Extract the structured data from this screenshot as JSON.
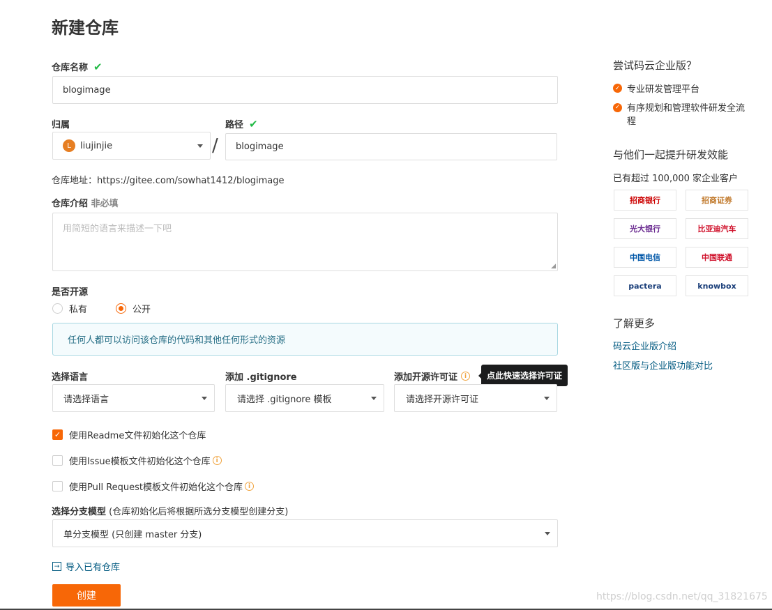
{
  "page": {
    "title": "新建仓库"
  },
  "repo_name": {
    "label": "仓库名称",
    "value": "blogimage"
  },
  "owner": {
    "label": "归属",
    "avatar_letter": "L",
    "value": "liujinjie"
  },
  "separator": "/",
  "path": {
    "label": "路径",
    "value": "blogimage"
  },
  "repo_address": "仓库地址：https://gitee.com/sowhat1412/blogimage",
  "description": {
    "label": "仓库介绍",
    "optional": "非必填",
    "placeholder": "用简短的语言来描述一下吧"
  },
  "open_source": {
    "label": "是否开源",
    "private_label": "私有",
    "public_label": "公开",
    "selected": "public",
    "notice": "任何人都可以访问该仓库的代码和其他任何形式的资源"
  },
  "language": {
    "label": "选择语言",
    "value": "请选择语言"
  },
  "gitignore": {
    "label": "添加 .gitignore",
    "value": "请选择 .gitignore 模板"
  },
  "license": {
    "label": "添加开源许可证",
    "value": "请选择开源许可证",
    "tooltip": "点此快速选择许可证"
  },
  "init_options": [
    {
      "label": "使用Readme文件初始化这个仓库",
      "checked": true
    },
    {
      "label": "使用Issue模板文件初始化这个仓库",
      "checked": false
    },
    {
      "label": "使用Pull Request模板文件初始化这个仓库",
      "checked": false
    }
  ],
  "branch_model": {
    "label": "选择分支模型",
    "hint": "(仓库初始化后将根据所选分支模型创建分支)",
    "value": "单分支模型 (只创建 master 分支)"
  },
  "import_link": "导入已有仓库",
  "create_button": "创建",
  "sidebar": {
    "enterprise_title": "尝试码云企业版？",
    "features": [
      "专业研发管理平台",
      "有序规划和管理软件研发全流程"
    ],
    "join_title": "与他们一起提升研发效能",
    "customers": "已有超过 100,000 家企业客户",
    "logos": [
      "招商银行",
      "招商证券",
      "光大银行",
      "比亚迪汽车",
      "中国电信",
      "中国联通",
      "pactera",
      "knowbox"
    ],
    "learn_title": "了解更多",
    "links": [
      "码云企业版介绍",
      "社区版与企业版功能对比"
    ]
  },
  "watermark": "https://blog.csdn.net/qq_31821675",
  "colors": {
    "accent": "#f76707",
    "check": "#21ba45",
    "link": "#005980",
    "notice_bg": "#f4fbfd",
    "notice_border": "#a7d7e2"
  }
}
